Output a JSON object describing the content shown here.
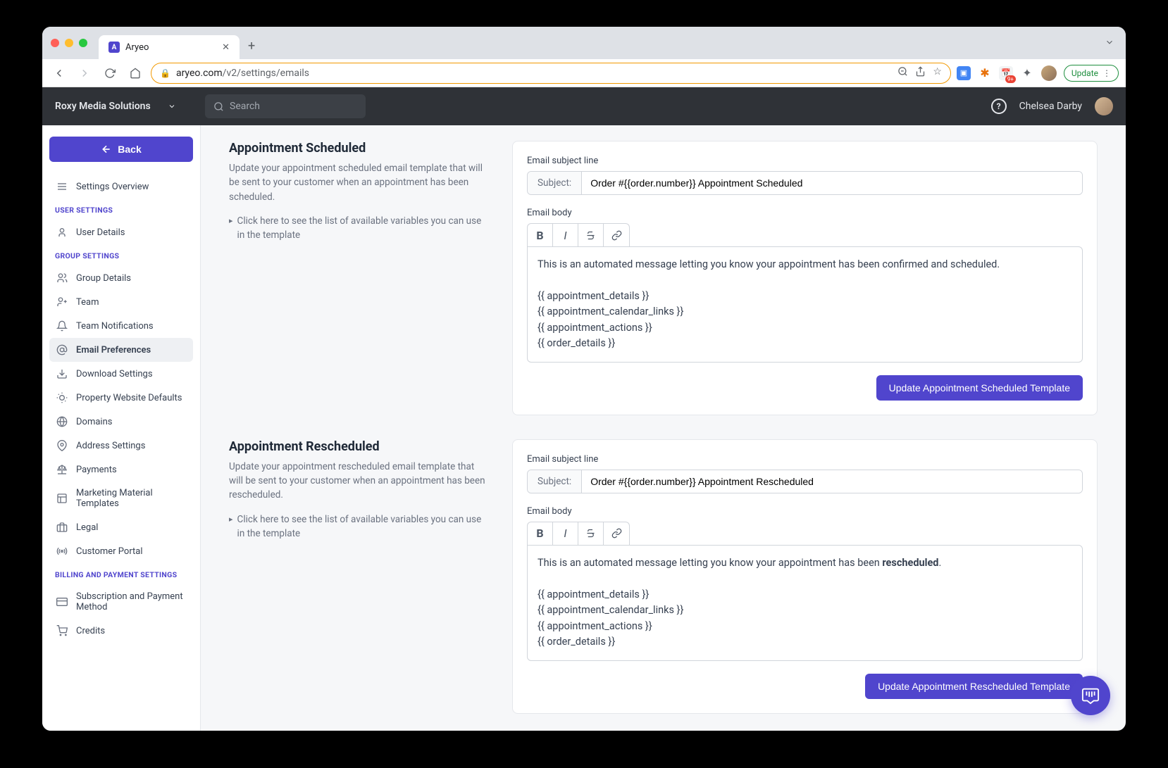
{
  "browser": {
    "tab_title": "Aryeo",
    "url_domain": "aryeo.com",
    "url_path": "/v2/settings/emails",
    "update_label": "Update"
  },
  "topbar": {
    "org_name": "Roxy Media Solutions",
    "search_placeholder": "Search",
    "user_name": "Chelsea Darby"
  },
  "sidebar": {
    "back_label": "Back",
    "overview": "Settings Overview",
    "sections": [
      {
        "title": "USER SETTINGS",
        "items": [
          "User Details"
        ]
      },
      {
        "title": "GROUP SETTINGS",
        "items": [
          "Group Details",
          "Team",
          "Team Notifications",
          "Email Preferences",
          "Download Settings",
          "Property Website Defaults",
          "Domains",
          "Address Settings",
          "Payments",
          "Marketing Material Templates",
          "Legal",
          "Customer Portal"
        ]
      },
      {
        "title": "BILLING AND PAYMENT SETTINGS",
        "items": [
          "Subscription and Payment Method",
          "Credits"
        ]
      }
    ]
  },
  "sections": [
    {
      "title": "Appointment Scheduled",
      "desc": "Update your appointment scheduled email template that will be sent to your customer when an appointment has been scheduled.",
      "note": "Click here to see the list of available variables you can use in the template",
      "subject_label_heading": "Email subject line",
      "subject_prefix": "Subject:",
      "subject_value": "Order #{{order.number}} Appointment Scheduled",
      "body_label": "Email body",
      "body_line1": "This is an automated message letting you know your appointment has been confirmed and scheduled.",
      "body_var1": "{{ appointment_details }}",
      "body_var2": "{{ appointment_calendar_links }}",
      "body_var3": "{{ appointment_actions }}",
      "body_var4": "{{ order_details }}",
      "button": "Update Appointment Scheduled Template"
    },
    {
      "title": "Appointment Rescheduled",
      "desc": "Update your appointment rescheduled email template that will be sent to your customer when an appointment has been rescheduled.",
      "note": "Click here to see the list of available variables you can use in the template",
      "subject_label_heading": "Email subject line",
      "subject_prefix": "Subject:",
      "subject_value": "Order #{{order.number}} Appointment Rescheduled",
      "body_label": "Email body",
      "body_line1_pre": "This is an automated message letting you know your appointment has been ",
      "body_line1_bold": "rescheduled",
      "body_line1_post": ".",
      "body_var1": "{{ appointment_details }}",
      "body_var2": "{{ appointment_calendar_links }}",
      "body_var3": "{{ appointment_actions }}",
      "body_var4": "{{ order_details }}",
      "button": "Update Appointment Rescheduled Template"
    }
  ]
}
